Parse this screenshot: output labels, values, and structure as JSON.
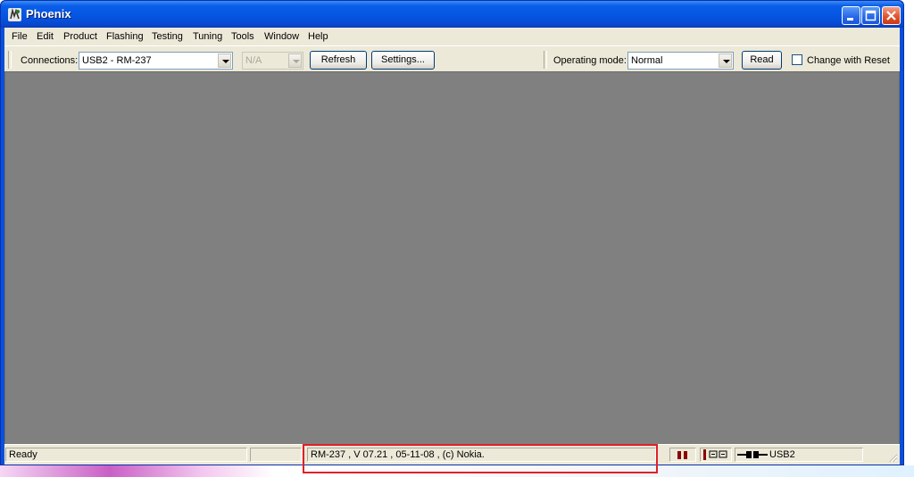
{
  "window": {
    "title": "Phoenix",
    "controls": [
      "minimize-icon",
      "maximize-icon",
      "close-icon"
    ],
    "titlebar_color": "#0556e3"
  },
  "menu": [
    "File",
    "Edit",
    "Product",
    "Flashing",
    "Testing",
    "Tuning",
    "Tools",
    "Window",
    "Help"
  ],
  "toolbar": {
    "connections_label": "Connections:",
    "connection_value": "USB2 - RM-237",
    "secondary_value": "N/A",
    "refresh_label": "Refresh",
    "settings_label": "Settings...",
    "operating_mode_label": "Operating mode:",
    "operating_mode_value": "Normal",
    "read_label": "Read",
    "change_with_reset_label": "Change with Reset",
    "change_with_reset_checked": false
  },
  "statusbar": {
    "status": "Ready",
    "product_info": "RM-237 , V 07.21 , 05-11-08 , (c) Nokia.",
    "connection": "USB2",
    "indicator_color": "#8b0000"
  },
  "annotation": {
    "highlight_color": "#e0202a"
  }
}
